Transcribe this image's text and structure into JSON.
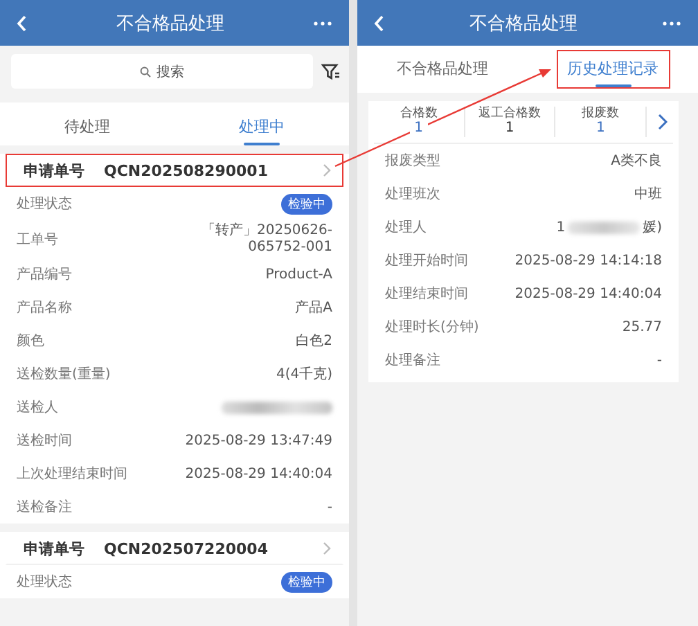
{
  "left_screen": {
    "title": "不合格品处理",
    "search": {
      "placeholder": "搜索"
    },
    "tabs": [
      {
        "label": "待处理",
        "selected": false
      },
      {
        "label": "处理中",
        "selected": true
      }
    ],
    "cards": [
      {
        "request_label": "申请单号",
        "request_no": "QCN202508290001",
        "highlighted": true,
        "fields": [
          {
            "kind": "badge",
            "label": "处理状态",
            "value": "检验中"
          },
          {
            "kind": "text",
            "label": "工单号",
            "value": "「转产」20250626-065752-001"
          },
          {
            "kind": "text",
            "label": "产品编号",
            "value": "Product-A"
          },
          {
            "kind": "text",
            "label": "产品名称",
            "value": "产品A"
          },
          {
            "kind": "text",
            "label": "颜色",
            "value": "白色2"
          },
          {
            "kind": "text",
            "label": "送检数量(重量)",
            "value": "4(4千克)"
          },
          {
            "kind": "blurred",
            "label": "送检人"
          },
          {
            "kind": "text",
            "label": "送检时间",
            "value": "2025-08-29 13:47:49"
          },
          {
            "kind": "text",
            "label": "上次处理结束时间",
            "value": "2025-08-29 14:40:04"
          },
          {
            "kind": "text",
            "label": "送检备注",
            "value": "-"
          }
        ]
      },
      {
        "request_label": "申请单号",
        "request_no": "QCN202507220004",
        "highlighted": false,
        "fields": [
          {
            "kind": "badge",
            "label": "处理状态",
            "value": "检验中"
          }
        ]
      }
    ]
  },
  "right_screen": {
    "title": "不合格品处理",
    "tabs": [
      {
        "label": "不合格品处理",
        "selected": false,
        "highlighted": false
      },
      {
        "label": "历史处理记录",
        "selected": true,
        "highlighted": true
      }
    ],
    "stats": [
      {
        "label": "合格数",
        "value": "1",
        "color": "#3a6fc0"
      },
      {
        "label": "返工合格数",
        "value": "1",
        "color": "#333333"
      },
      {
        "label": "报废数",
        "value": "1",
        "color": "#3a6fc0"
      }
    ],
    "fields": [
      {
        "kind": "text",
        "label": "报废类型",
        "value": "A类不良"
      },
      {
        "kind": "text",
        "label": "处理班次",
        "value": "中班"
      },
      {
        "kind": "partly_blurred",
        "label": "处理人",
        "value_start": "1",
        "value_end": "媛)"
      },
      {
        "kind": "text",
        "label": "处理开始时间",
        "value": "2025-08-29 14:14:18"
      },
      {
        "kind": "text",
        "label": "处理结束时间",
        "value": "2025-08-29 14:40:04"
      },
      {
        "kind": "text",
        "label": "处理时长(分钟)",
        "value": "25.77"
      },
      {
        "kind": "text",
        "label": "处理备注",
        "value": "-"
      }
    ]
  }
}
